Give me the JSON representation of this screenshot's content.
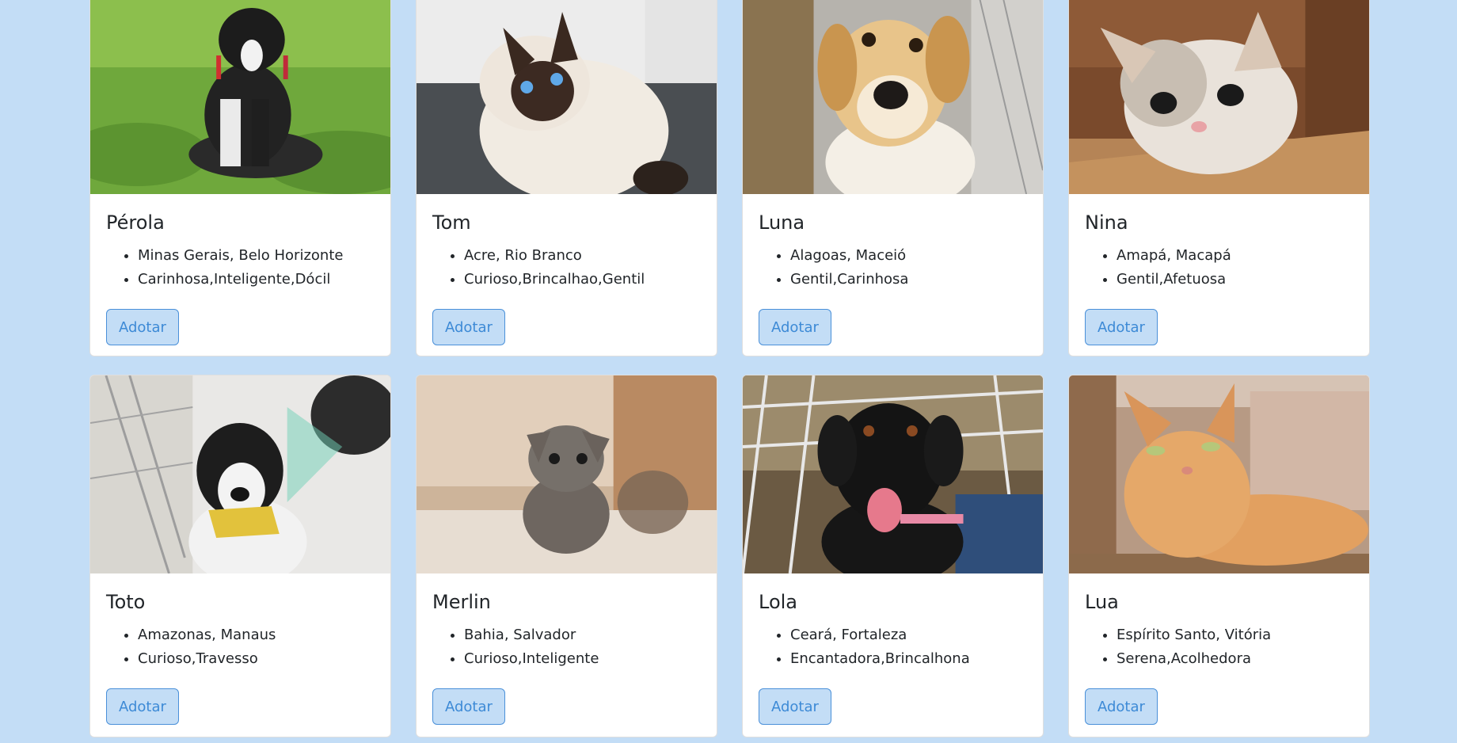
{
  "pets": [
    {
      "name": "Pérola",
      "location": "Minas Gerais, Belo Horizonte",
      "traits": "Carinhosa,Inteligente,Dócil",
      "button": "Adotar",
      "photo": "puppy-on-grass"
    },
    {
      "name": "Tom",
      "location": "Acre, Rio Branco",
      "traits": "Curioso,Brincalhao,Gentil",
      "button": "Adotar",
      "photo": "siamese-cat"
    },
    {
      "name": "Luna",
      "location": "Alagoas, Maceió",
      "traits": "Gentil,Carinhosa",
      "button": "Adotar",
      "photo": "tan-dog-in-kennel"
    },
    {
      "name": "Nina",
      "location": "Amapá, Macapá",
      "traits": "Gentil,Afetuosa",
      "button": "Adotar",
      "photo": "kitten-in-box"
    },
    {
      "name": "Toto",
      "location": "Amazonas, Manaus",
      "traits": "Curioso,Travesso",
      "button": "Adotar",
      "photo": "black-white-puppy"
    },
    {
      "name": "Merlin",
      "location": "Bahia, Salvador",
      "traits": "Curioso,Inteligente",
      "button": "Adotar",
      "photo": "tabby-kitten"
    },
    {
      "name": "Lola",
      "location": "Ceará, Fortaleza",
      "traits": "Encantadora,Brincalhona",
      "button": "Adotar",
      "photo": "black-dog-in-cage"
    },
    {
      "name": "Lua",
      "location": "Espírito Santo, Vitória",
      "traits": "Serena,Acolhedora",
      "button": "Adotar",
      "photo": "orange-cat-in-box"
    }
  ],
  "colors": {
    "page_background": "#c3ddf6",
    "button_text": "#3d8ad6",
    "button_border": "#4a90d9"
  }
}
